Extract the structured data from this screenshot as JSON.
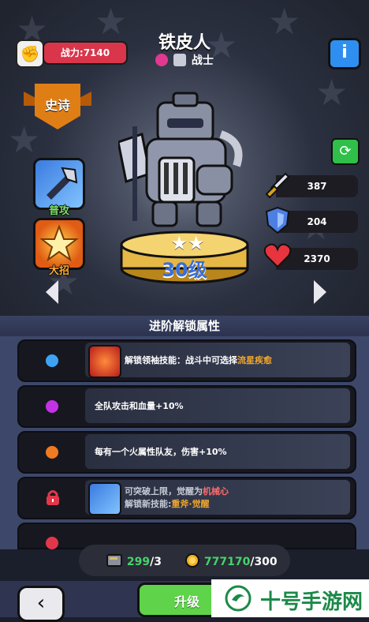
{
  "header": {
    "power_label": "战力:7140",
    "hero_name": "铁皮人",
    "hero_class": "战士",
    "info_label": "i"
  },
  "rarity": {
    "label": "史诗"
  },
  "skills": [
    {
      "label": "普攻",
      "icon": "axe-strike-icon"
    },
    {
      "label": "大招",
      "icon": "ultimate-burst-icon"
    }
  ],
  "hero": {
    "star_count": 2,
    "stars": "★★",
    "level_label": "30级"
  },
  "stats": [
    {
      "icon": "sword-icon",
      "value": "387"
    },
    {
      "icon": "shield-icon",
      "value": "204"
    },
    {
      "icon": "heart-icon",
      "value": "2370"
    }
  ],
  "section": {
    "title": "进阶解锁属性"
  },
  "unlocks": [
    {
      "dot_color": "#3fa3f5",
      "line1_prefix": "解锁领袖技能：战斗中可选择",
      "line1_highlight": "流星疾愈",
      "has_pic": true,
      "locked": false
    },
    {
      "dot_color": "#c233e6",
      "text": "全队攻击和血量+10%",
      "has_pic": false,
      "locked": false
    },
    {
      "dot_color": "#f07a22",
      "text": "每有一个火属性队友，伤害+10%",
      "has_pic": false,
      "locked": false
    },
    {
      "locked": true,
      "line1_prefix": "可突破上限，觉醒为",
      "line1_highlight": "机械心",
      "line2_prefix": "解锁新技能:",
      "line2_highlight": "重斧·觉醒",
      "has_pic": true
    }
  ],
  "resources": {
    "books_current": "299",
    "books_total": "/3",
    "gold_current": "777170",
    "gold_total": "/300"
  },
  "footer": {
    "upgrade_label": "升级",
    "watermark_text": "十号手游网"
  },
  "colors": {
    "power_bar": "#d9364b",
    "upgrade": "#5fd34a",
    "highlight": "#f0a62b"
  }
}
